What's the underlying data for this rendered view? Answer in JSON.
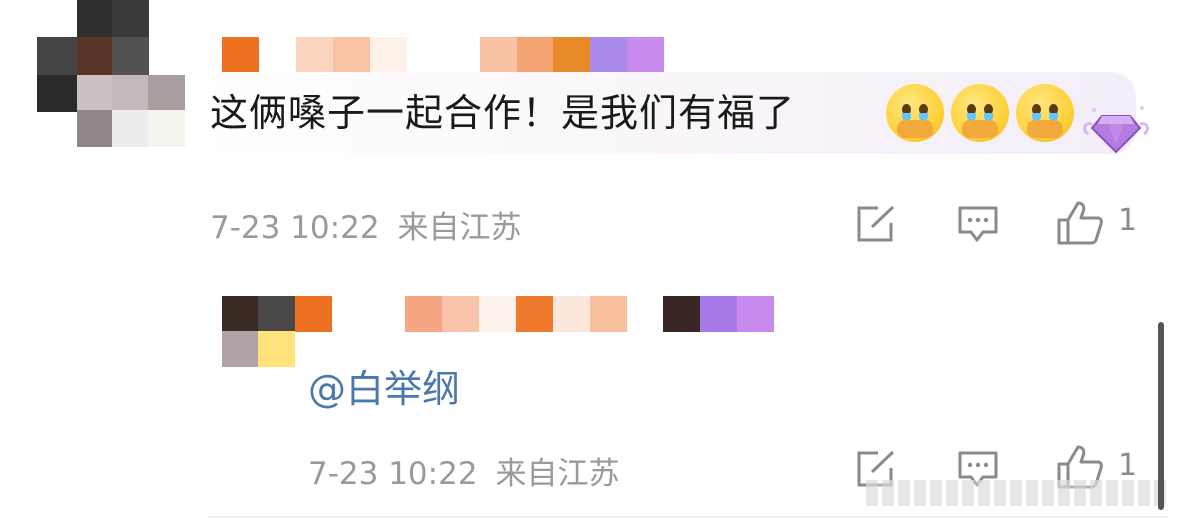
{
  "comment": {
    "text": "这俩嗓子一起合作！是我们有福了",
    "emojis": [
      "crying-covering-mouth-emoji",
      "crying-covering-mouth-emoji",
      "crying-covering-mouth-emoji"
    ],
    "badge_icon": "purple-diamond-badge-icon",
    "timestamp": "7-23 10:22",
    "location": "来自江苏",
    "like_count": "1"
  },
  "reply": {
    "mention": "@白举纲",
    "timestamp": "7-23 10:22",
    "location": "来自江苏",
    "like_count": "1"
  },
  "icons": {
    "share": "share-icon",
    "comment": "comment-icon",
    "like": "thumbs-up-icon"
  },
  "colors": {
    "mention": "#4a78a8",
    "meta_text": "#9a9a9a",
    "badge": "#a66bd6"
  }
}
